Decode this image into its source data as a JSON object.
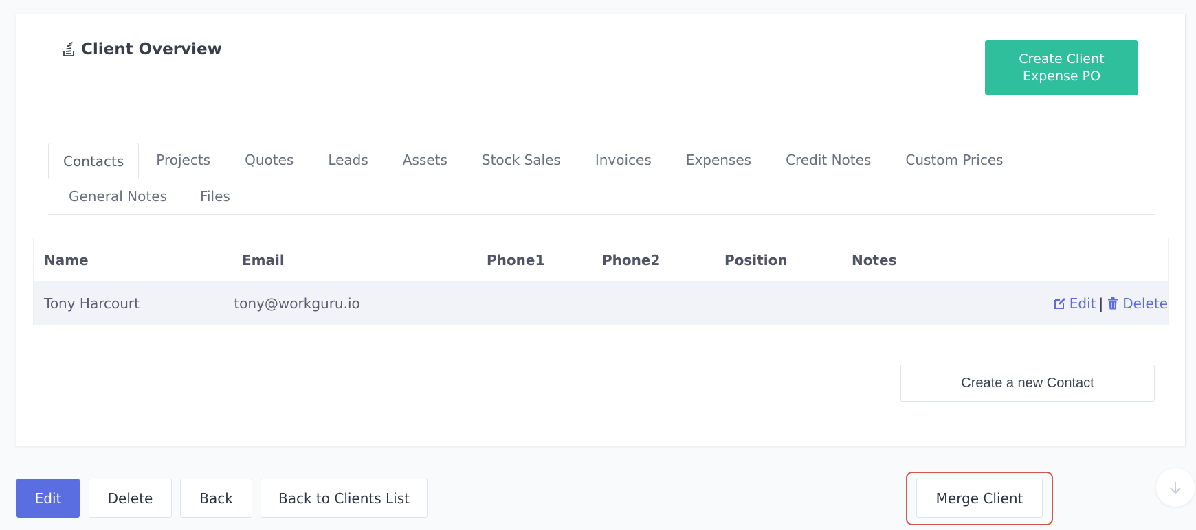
{
  "header": {
    "title": "Client Overview",
    "title_icon": "stack-overflow-icon",
    "create_po_label": "Create Client\nExpense PO"
  },
  "tabs": [
    {
      "label": "Contacts",
      "active": true
    },
    {
      "label": "Projects"
    },
    {
      "label": "Quotes"
    },
    {
      "label": "Leads"
    },
    {
      "label": "Assets"
    },
    {
      "label": "Stock Sales"
    },
    {
      "label": "Invoices"
    },
    {
      "label": "Expenses"
    },
    {
      "label": "Credit Notes"
    },
    {
      "label": "Custom Prices"
    },
    {
      "label": "General Notes"
    },
    {
      "label": "Files"
    }
  ],
  "table": {
    "columns": [
      "Name",
      "Email",
      "Phone1",
      "Phone2",
      "Position",
      "Notes",
      ""
    ],
    "rows": [
      {
        "name": "Tony Harcourt",
        "email": "tony@workguru.io",
        "phone1": "",
        "phone2": "",
        "position": "",
        "notes": ""
      }
    ],
    "edit_label": "Edit",
    "separator": "|",
    "delete_label": "Delete"
  },
  "create_contact_label": "Create a new Contact",
  "footer": {
    "edit_label": "Edit",
    "delete_label": "Delete",
    "back_label": "Back",
    "back_list_label": "Back to Clients List",
    "merge_label": "Merge Client"
  },
  "colors": {
    "accent": "#5b6ee1",
    "success": "#2fbf9c",
    "highlight": "#d9534f",
    "link": "#5c6be0"
  }
}
